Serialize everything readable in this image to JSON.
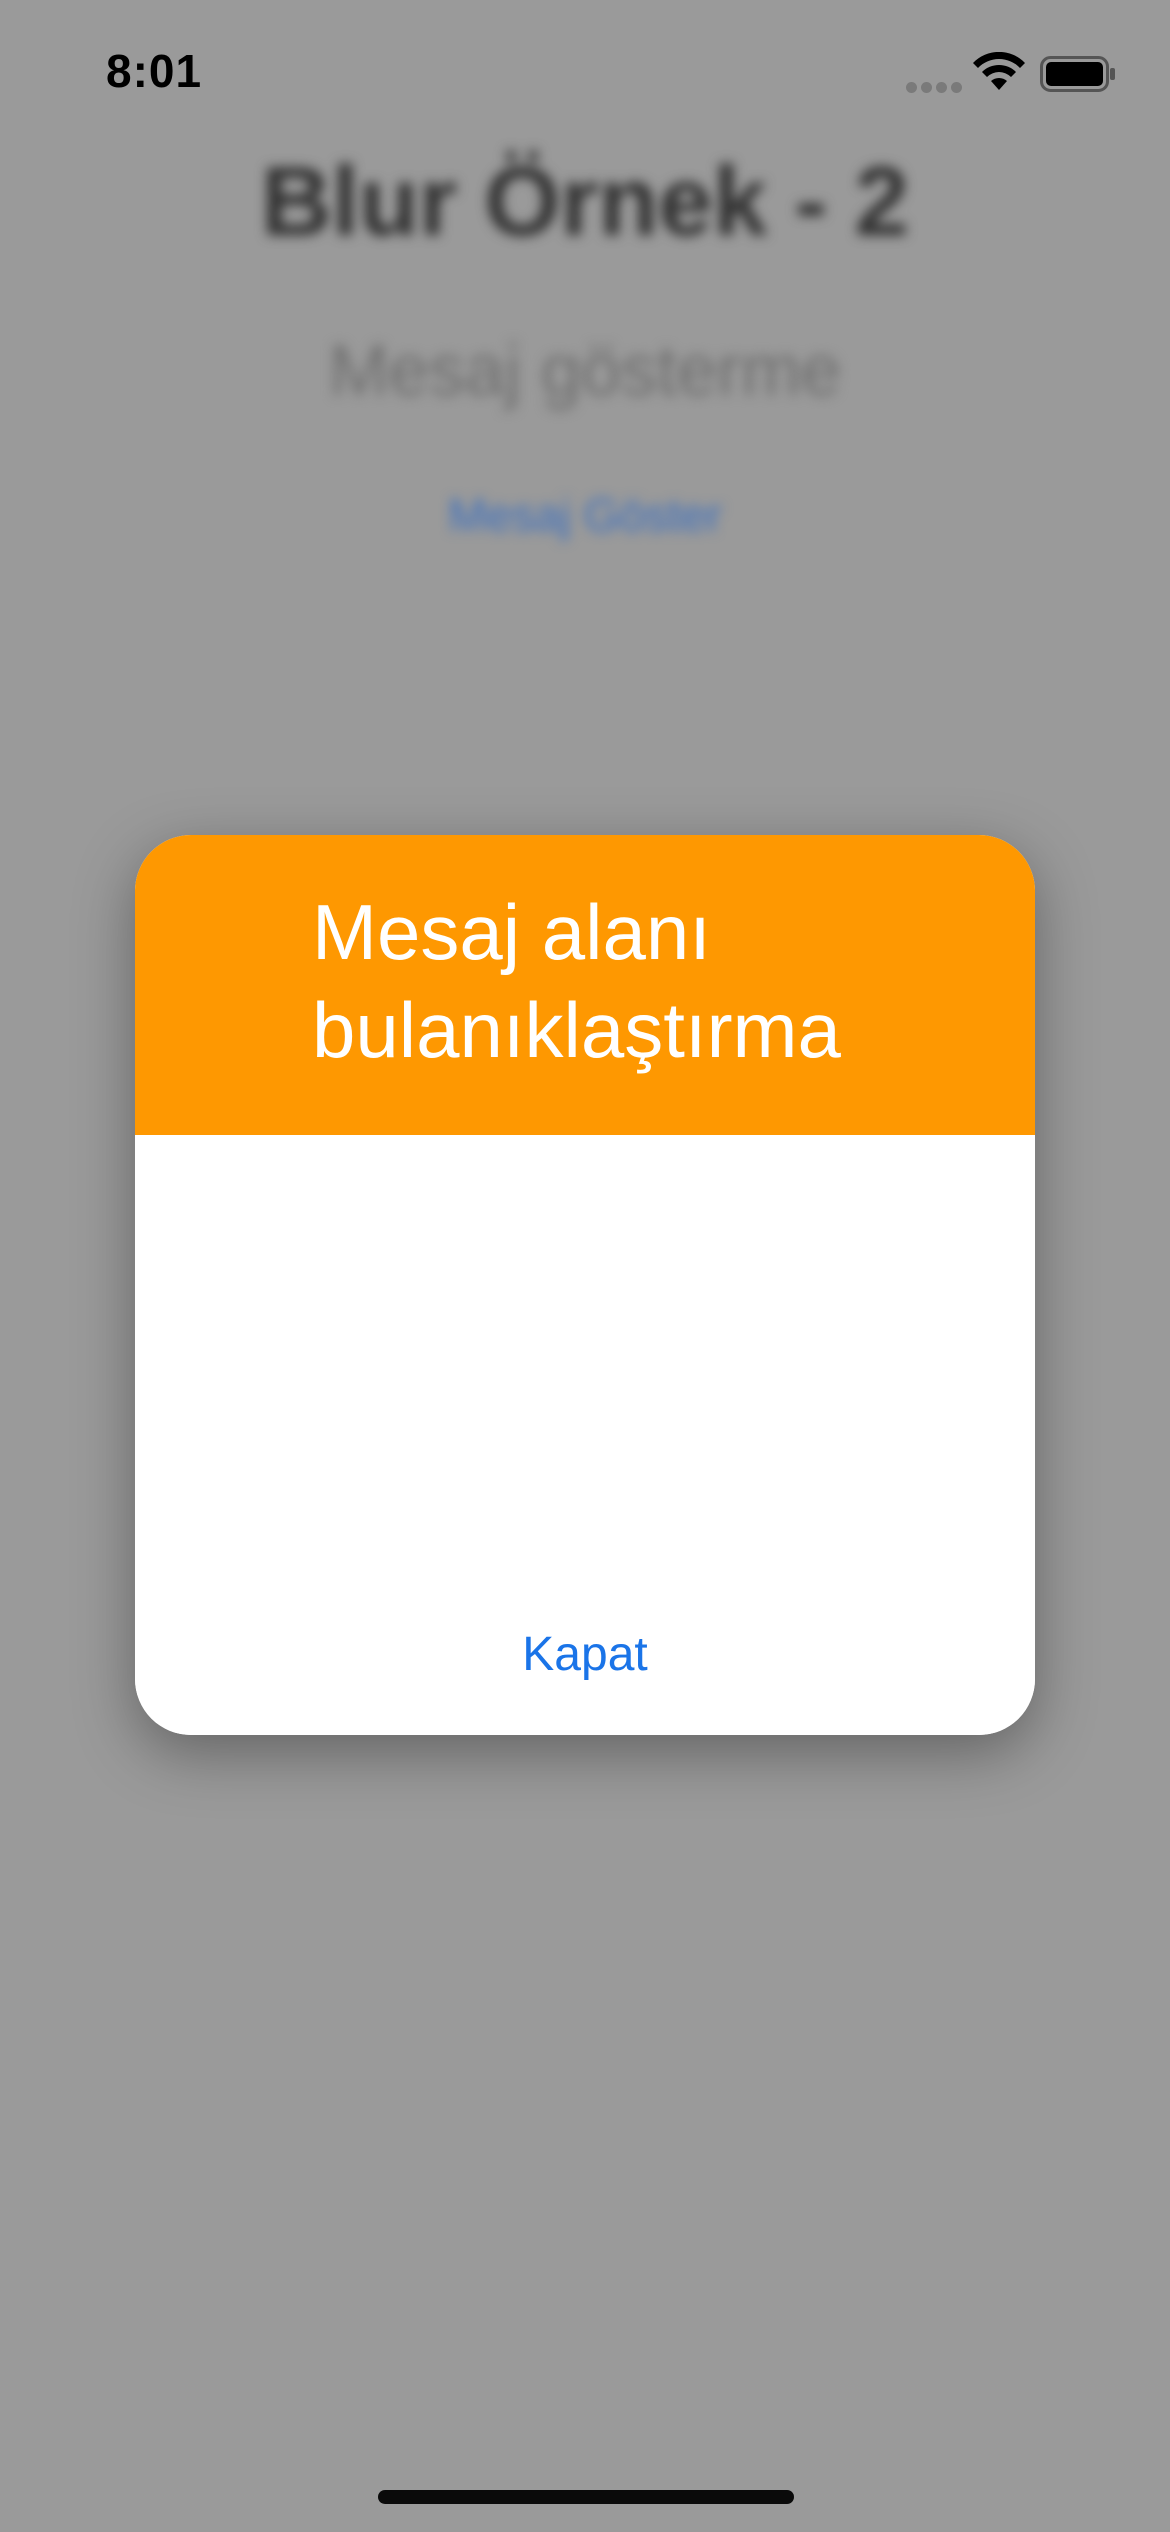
{
  "status_bar": {
    "time": "8:01",
    "icons": [
      "cellular-signal-icon",
      "wifi-icon",
      "battery-icon"
    ]
  },
  "background": {
    "title": "Blur Örnek - 2",
    "subtitle": "Mesaj gösterme",
    "show_message_button": "Mesaj Göster"
  },
  "dialog": {
    "title": "Mesaj alanı bulanıklaştırma",
    "close_button": "Kapat"
  },
  "colors": {
    "overlay": "#9a9a9a",
    "dialog_header": "#fe9801",
    "dialog_body": "#ffffff",
    "link_blue": "#1a74e8"
  }
}
